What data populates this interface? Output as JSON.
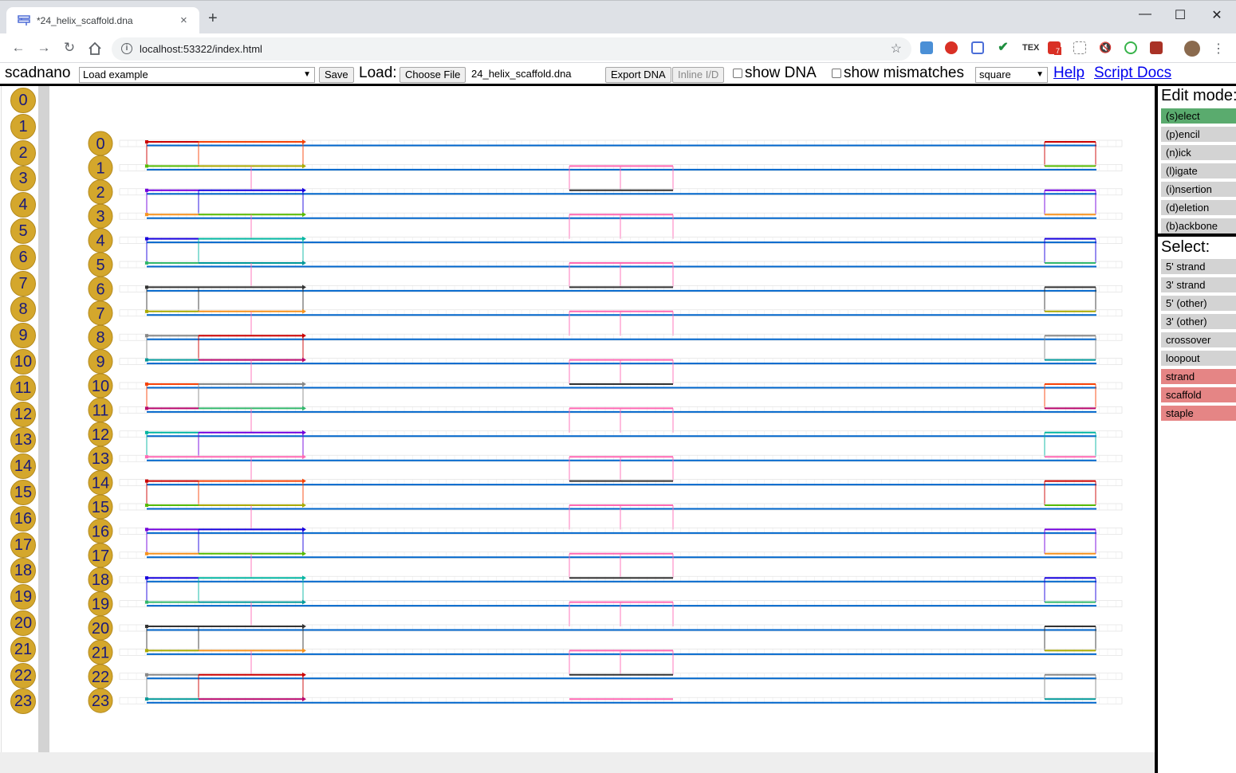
{
  "browser": {
    "tab_title": "*24_helix_scaffold.dna",
    "url": "localhost:53322/index.html",
    "new_tab_glyph": "+",
    "close_glyph": "×",
    "minimize_glyph": "—",
    "maximize_glyph": "☐",
    "window_close_glyph": "✕",
    "ext_badge_count": "7"
  },
  "menubar": {
    "app_name": "scadnano",
    "load_example": "Load example",
    "save_label": "Save",
    "load_label": "Load:",
    "choose_file_label": "Choose File",
    "file_name": "24_helix_scaffold.dna",
    "export_dna_label": "Export DNA",
    "inline_id_label": "Inline I/D",
    "show_dna_label": "show DNA",
    "show_mismatches_label": "show mismatches",
    "grid_select_value": "square",
    "help_label": "Help",
    "script_docs_label": "Script Docs"
  },
  "helices": [
    "0",
    "1",
    "2",
    "3",
    "4",
    "5",
    "6",
    "7",
    "8",
    "9",
    "10",
    "11",
    "12",
    "13",
    "14",
    "15",
    "16",
    "17",
    "18",
    "19",
    "20",
    "21",
    "22",
    "23"
  ],
  "edit_mode": {
    "heading": "Edit mode:",
    "items": [
      {
        "label": "(s)elect",
        "state": "active"
      },
      {
        "label": "(p)encil",
        "state": "off"
      },
      {
        "label": "(n)ick",
        "state": "off"
      },
      {
        "label": "(l)igate",
        "state": "off"
      },
      {
        "label": "(i)nsertion",
        "state": "off"
      },
      {
        "label": "(d)eletion",
        "state": "off"
      },
      {
        "label": "(b)ackbone",
        "state": "off"
      }
    ]
  },
  "select_mode": {
    "heading": "Select:",
    "items": [
      {
        "label": "5' strand",
        "state": "off"
      },
      {
        "label": "3' strand",
        "state": "off"
      },
      {
        "label": "5' (other)",
        "state": "off"
      },
      {
        "label": "3' (other)",
        "state": "off"
      },
      {
        "label": "crossover",
        "state": "off"
      },
      {
        "label": "loopout",
        "state": "off"
      },
      {
        "label": "strand",
        "state": "on"
      },
      {
        "label": "scaffold",
        "state": "on"
      },
      {
        "label": "staple",
        "state": "on"
      }
    ]
  },
  "colors": {
    "helix_circle": "#d4a72c",
    "helix_number": "#1a1a7a",
    "scaffold": "#0066cc",
    "mode_active": "#5aab6e",
    "select_on": "#e58585",
    "staple_palette": [
      "#cc0000",
      "#32b86c",
      "#f74308",
      "#57bb00",
      "#333333",
      "#b8056c",
      "#7300de",
      "#aaaa00",
      "#03b6a2",
      "#f7931e",
      "#888888",
      "#ff69b4",
      "#1700de",
      "#009999"
    ]
  }
}
